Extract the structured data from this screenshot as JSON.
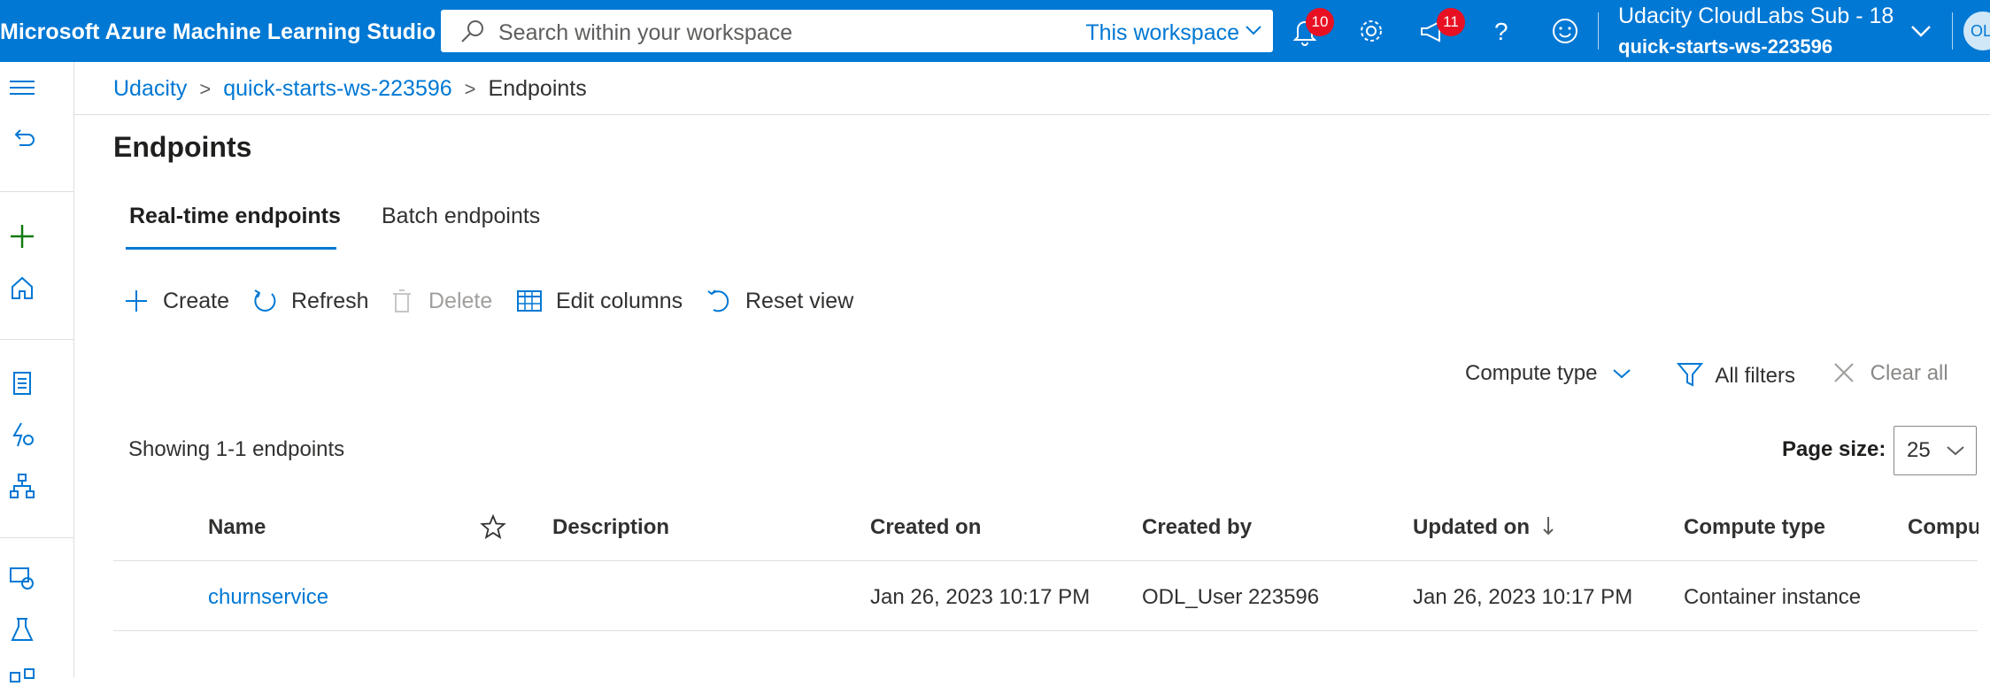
{
  "topbar": {
    "app_title": "Microsoft Azure Machine Learning Studio",
    "search_placeholder": "Search within your workspace",
    "search_scope": "This workspace",
    "notifications_count": "10",
    "announcements_count": "11",
    "account_subscription": "Udacity CloudLabs Sub - 18",
    "account_workspace": "quick-starts-ws-223596",
    "avatar_initials": "OL",
    "icons": [
      "search-icon",
      "chevron-down-icon",
      "bell-icon",
      "gear-icon",
      "megaphone-icon",
      "help-icon",
      "smiley-icon",
      "chevron-down-icon"
    ]
  },
  "leftnav": {
    "icons": [
      "hamburger-icon",
      "back-icon",
      "plus-icon",
      "home-icon",
      "notebook-icon",
      "automl-icon",
      "designer-icon",
      "data-icon",
      "experiments-icon",
      "pipelines-icon"
    ]
  },
  "breadcrumb": {
    "items": [
      "Udacity",
      "quick-starts-ws-223596",
      "Endpoints"
    ]
  },
  "page": {
    "title": "Endpoints",
    "tabs": [
      "Real-time endpoints",
      "Batch endpoints"
    ],
    "active_tab": "Real-time endpoints"
  },
  "toolbar": {
    "create": "Create",
    "refresh": "Refresh",
    "delete": "Delete",
    "edit_columns": "Edit columns",
    "reset_view": "Reset view"
  },
  "filters": {
    "compute_type": "Compute type",
    "all_filters": "All filters",
    "clear_all": "Clear all"
  },
  "listing": {
    "showing": "Showing 1-1 endpoints",
    "page_size_label": "Page size:",
    "page_size_value": "25"
  },
  "table": {
    "columns": [
      "Name",
      "Description",
      "Created on",
      "Created by",
      "Updated on",
      "Compute type",
      "Compu"
    ],
    "rows": [
      {
        "name": "churnservice",
        "description": "",
        "created_on": "Jan 26, 2023 10:17 PM",
        "created_by": "ODL_User 223596",
        "updated_on": "Jan 26, 2023 10:17 PM",
        "compute_type": "Container instance"
      }
    ]
  },
  "colors": {
    "brand": "#0078d4",
    "badge": "#e81123",
    "border": "#e1dfdd"
  }
}
